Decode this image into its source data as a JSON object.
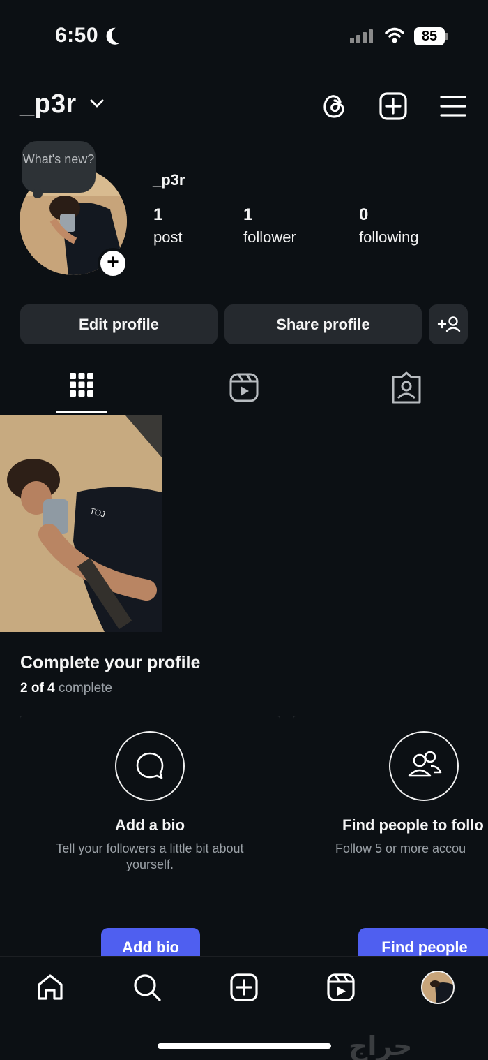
{
  "status_bar": {
    "time": "6:50",
    "battery": "85",
    "icons": [
      "moon-icon",
      "signal-icon",
      "wifi-icon",
      "battery-icon"
    ]
  },
  "header": {
    "username": "_p3r",
    "icons": [
      "chevron-down-icon",
      "threads-icon",
      "create-post-icon",
      "menu-icon"
    ]
  },
  "profile": {
    "note": "What's new?",
    "name": "_p3r",
    "stats": [
      {
        "value": "1",
        "label": "post"
      },
      {
        "value": "1",
        "label": "follower"
      },
      {
        "value": "0",
        "label": "following"
      }
    ]
  },
  "actions": {
    "edit_profile": "Edit profile",
    "share_profile": "Share profile"
  },
  "tabs": [
    "grid-icon",
    "reels-icon",
    "tagged-icon"
  ],
  "complete_profile": {
    "title": "Complete your profile",
    "progress_count": "2 of 4",
    "progress_label": "complete",
    "cards": [
      {
        "icon": "chat-bubble-icon",
        "title": "Add a bio",
        "subtitle": "Tell your followers a little bit about yourself.",
        "button": "Add bio"
      },
      {
        "icon": "people-icon",
        "title": "Find people to follo",
        "subtitle": "Follow 5 or more accou",
        "button": "Find people"
      }
    ]
  },
  "bottom_nav": [
    "home-icon",
    "search-icon",
    "create-icon",
    "reels-icon",
    "profile-avatar"
  ],
  "watermark": "حراج",
  "colors": {
    "background": "#0c1014",
    "button_bg": "#25292e",
    "accent": "#4f5ff0",
    "muted_text": "#9aa0a6"
  }
}
